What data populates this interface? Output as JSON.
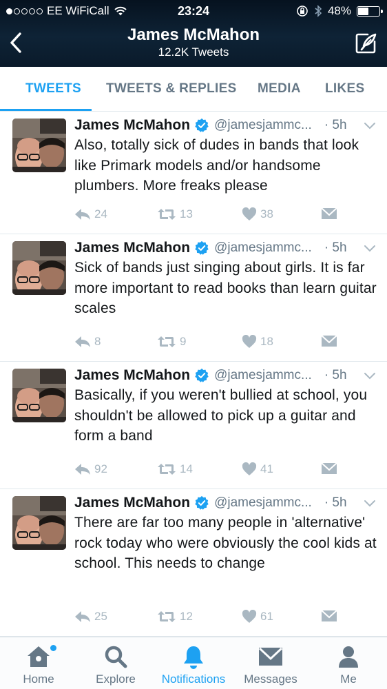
{
  "status_bar": {
    "carrier": "EE WiFiCall",
    "time": "23:24",
    "battery_percent_label": "48%",
    "battery_level": 0.48
  },
  "header": {
    "name": "James McMahon",
    "tweet_count": "12.2K Tweets"
  },
  "tabs": [
    {
      "label": "TWEETS",
      "active": true
    },
    {
      "label": "TWEETS & REPLIES",
      "active": false
    },
    {
      "label": "MEDIA",
      "active": false
    },
    {
      "label": "LIKES",
      "active": false
    }
  ],
  "tweets": [
    {
      "name": "James McMahon",
      "handle": "@jamesjammc...",
      "time": "· 5h",
      "text": "Also, totally sick of dudes in bands that look like Primark models and/or handsome plumbers. More freaks please",
      "replies": "24",
      "retweets": "13",
      "likes": "38"
    },
    {
      "name": "James McMahon",
      "handle": "@jamesjammc...",
      "time": "· 5h",
      "text": "Sick of bands just singing about girls. It is far more important to read books than learn guitar scales",
      "replies": "8",
      "retweets": "9",
      "likes": "18"
    },
    {
      "name": "James McMahon",
      "handle": "@jamesjammc...",
      "time": "· 5h",
      "text": "Basically, if you weren't bullied at school, you shouldn't be allowed to pick up a guitar and form a band",
      "replies": "92",
      "retweets": "14",
      "likes": "41"
    },
    {
      "name": "James McMahon",
      "handle": "@jamesjammc...",
      "time": "· 5h",
      "text": "There are far too many people in 'alternative' rock today who were obviously the cool kids at school. This needs to change",
      "replies": "25",
      "retweets": "12",
      "likes": "61"
    }
  ],
  "bottom_nav": [
    {
      "label": "Home",
      "icon": "home-icon"
    },
    {
      "label": "Explore",
      "icon": "search-icon"
    },
    {
      "label": "Notifications",
      "icon": "bell-icon",
      "active": true
    },
    {
      "label": "Messages",
      "icon": "envelope-icon"
    },
    {
      "label": "Me",
      "icon": "person-icon"
    }
  ],
  "colors": {
    "accent": "#1da1f2",
    "muted": "#657786",
    "action_grey": "#aab8c2",
    "verified": "#1da1f2"
  }
}
